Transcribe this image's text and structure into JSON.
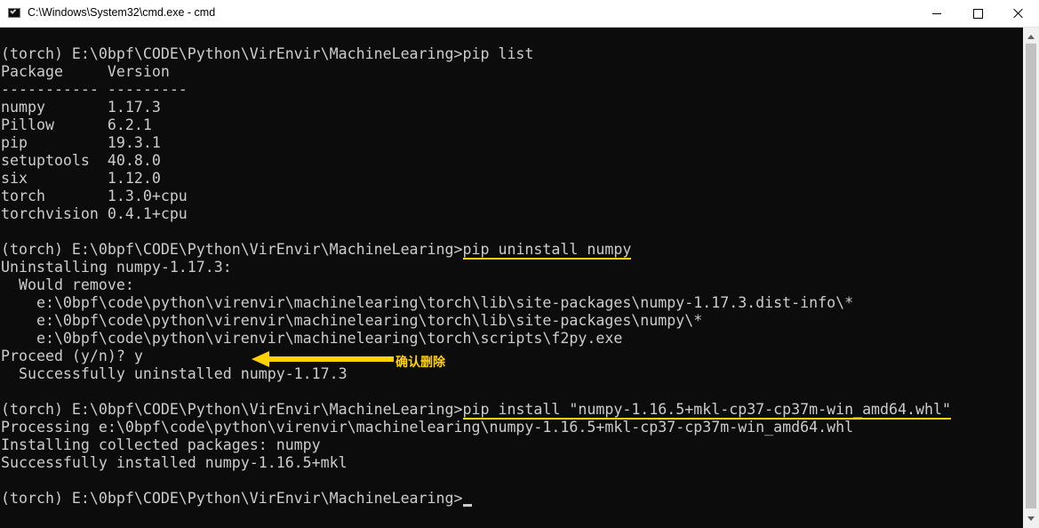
{
  "window": {
    "title": "C:\\Windows\\System32\\cmd.exe - cmd",
    "icon": "terminal-icon"
  },
  "console": {
    "lines": [
      "(torch) E:\\0bpf\\CODE\\Python\\VirEnvir\\MachineLearing>pip list",
      "Package     Version",
      "----------- ---------",
      "numpy       1.17.3",
      "Pillow      6.2.1",
      "pip         19.3.1",
      "setuptools  40.8.0",
      "six         1.12.0",
      "torch       1.3.0+cpu",
      "torchvision 0.4.1+cpu",
      "",
      "(torch) E:\\0bpf\\CODE\\Python\\VirEnvir\\MachineLearing>pip uninstall numpy",
      "Uninstalling numpy-1.17.3:",
      "  Would remove:",
      "    e:\\0bpf\\code\\python\\virenvir\\machinelearing\\torch\\lib\\site-packages\\numpy-1.17.3.dist-info\\*",
      "    e:\\0bpf\\code\\python\\virenvir\\machinelearing\\torch\\lib\\site-packages\\numpy\\*",
      "    e:\\0bpf\\code\\python\\virenvir\\machinelearing\\torch\\scripts\\f2py.exe",
      "Proceed (y/n)? y",
      "  Successfully uninstalled numpy-1.17.3",
      "",
      "(torch) E:\\0bpf\\CODE\\Python\\VirEnvir\\MachineLearing>pip install \"numpy-1.16.5+mkl-cp37-cp37m-win_amd64.whl\"",
      "Processing e:\\0bpf\\code\\python\\virenvir\\machinelearing\\numpy-1.16.5+mkl-cp37-cp37m-win_amd64.whl",
      "Installing collected packages: numpy",
      "Successfully installed numpy-1.16.5+mkl",
      "",
      "(torch) E:\\0bpf\\CODE\\Python\\VirEnvir\\MachineLearing>"
    ],
    "prompt": "(torch) E:\\0bpf\\CODE\\Python\\VirEnvir\\MachineLearing>",
    "highlighted_commands": {
      "uninstall": "pip uninstall numpy",
      "install": "pip install \"numpy-1.16.5+mkl-cp37-cp37m-win_amd64.whl\""
    }
  },
  "annotation": {
    "text": "确认删除",
    "color": "#ffd200"
  },
  "colors": {
    "console_bg": "#0c0c0c",
    "console_text": "#cccccc",
    "highlight": "#ffd200"
  }
}
